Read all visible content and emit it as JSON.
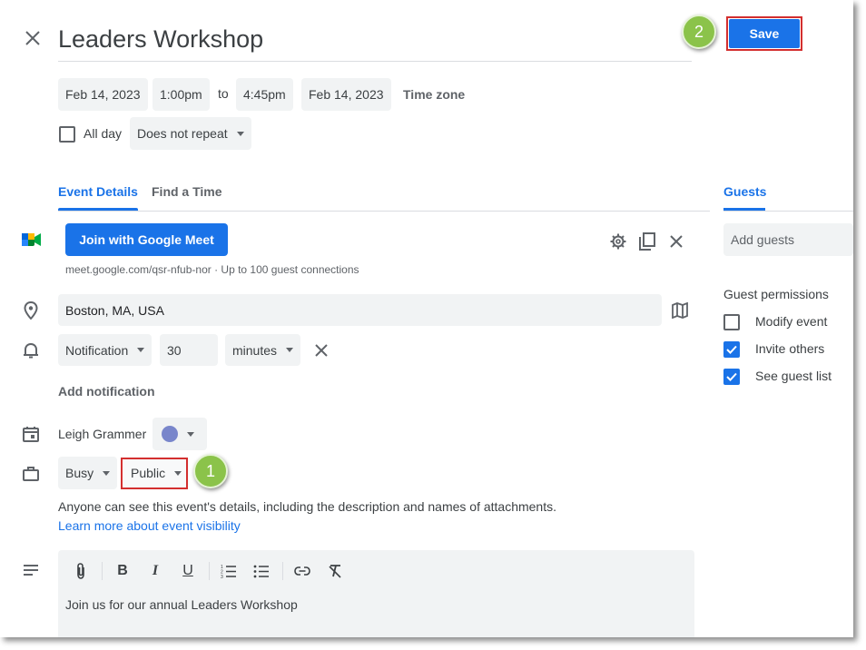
{
  "header": {
    "title": "Leaders Workshop",
    "save_label": "Save"
  },
  "datetime": {
    "start_date": "Feb 14, 2023",
    "start_time": "1:00pm",
    "to_label": "to",
    "end_time": "4:45pm",
    "end_date": "Feb 14, 2023",
    "timezone_label": "Time zone",
    "all_day_label": "All day",
    "repeat_value": "Does not repeat"
  },
  "tabs": {
    "event_details": "Event Details",
    "find_a_time": "Find a Time",
    "guests": "Guests"
  },
  "meet": {
    "button_label": "Join with Google Meet",
    "link_text": "meet.google.com/qsr-nfub-nor · Up to 100 guest connections"
  },
  "location": {
    "value": "Boston, MA, USA"
  },
  "notification": {
    "type": "Notification",
    "amount": "30",
    "unit": "minutes",
    "add_label": "Add notification"
  },
  "calendar": {
    "owner": "Leigh Grammer",
    "color": "#7986cb"
  },
  "availability": {
    "status": "Busy",
    "visibility": "Public",
    "visibility_note": "Anyone can see this event's details, including the description and names of attachments.",
    "learn_more": "Learn more about event visibility"
  },
  "description": {
    "text": "Join us for our annual Leaders Workshop"
  },
  "guests": {
    "add_placeholder": "Add guests",
    "permissions_title": "Guest permissions",
    "permissions": [
      {
        "label": "Modify event",
        "checked": false
      },
      {
        "label": "Invite others",
        "checked": true
      },
      {
        "label": "See guest list",
        "checked": true
      }
    ]
  },
  "annotations": {
    "marker_1": "1",
    "marker_2": "2"
  },
  "colors": {
    "accent": "#1a73e8",
    "highlight_box": "#d32f2f",
    "marker_green": "#8bc34a"
  }
}
